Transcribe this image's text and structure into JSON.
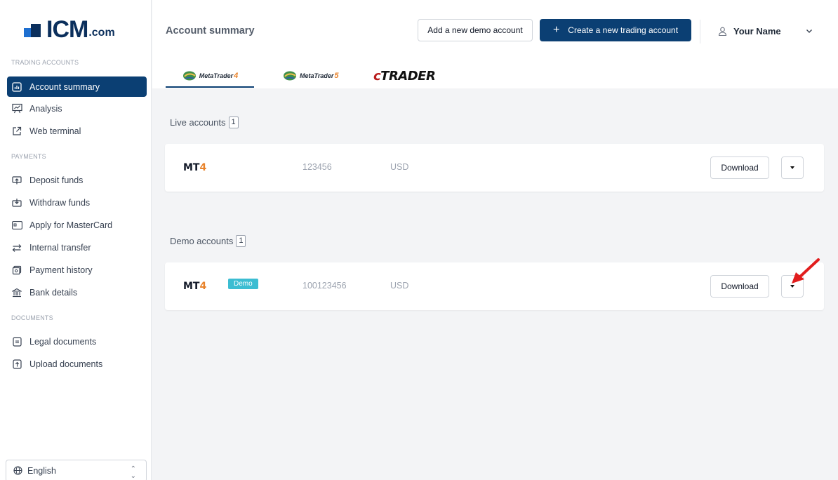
{
  "brand": {
    "name": "ICM",
    "suffix": ".com"
  },
  "sidebar": {
    "sections": [
      {
        "label": "TRADING ACCOUNTS"
      },
      {
        "label": "PAYMENTS"
      },
      {
        "label": "DOCUMENTS"
      }
    ],
    "items": [
      {
        "label": "Account summary",
        "icon": "chart-icon",
        "active": true
      },
      {
        "label": "Analysis",
        "icon": "presentation-icon"
      },
      {
        "label": "Web terminal",
        "icon": "external-link-icon"
      },
      {
        "label": "Deposit funds",
        "icon": "deposit-icon"
      },
      {
        "label": "Withdraw funds",
        "icon": "withdraw-icon"
      },
      {
        "label": "Apply for MasterCard",
        "icon": "card-icon"
      },
      {
        "label": "Internal transfer",
        "icon": "transfer-icon"
      },
      {
        "label": "Payment history",
        "icon": "history-icon"
      },
      {
        "label": "Bank details",
        "icon": "bank-icon"
      },
      {
        "label": "Legal documents",
        "icon": "document-icon"
      },
      {
        "label": "Upload documents",
        "icon": "upload-icon"
      }
    ],
    "language": "English"
  },
  "header": {
    "title": "Account summary",
    "add_demo": "Add a new demo account",
    "create_account": "Create a new trading account",
    "user_name": "Your Name"
  },
  "tabs": [
    {
      "brand": "MetaTrader",
      "num": "4",
      "active": true
    },
    {
      "brand": "MetaTrader",
      "num": "5"
    },
    {
      "label": "TRADER",
      "prefix": "c"
    }
  ],
  "live": {
    "title": "Live accounts",
    "count": "1",
    "platform": "MT",
    "platform_num": "4",
    "account": "123456",
    "currency": "USD",
    "download": "Download"
  },
  "demo": {
    "title": "Demo accounts",
    "count": "1",
    "platform": "MT",
    "platform_num": "4",
    "badge": "Demo",
    "account": "100123456",
    "currency": "USD",
    "download": "Download"
  },
  "colors": {
    "primary": "#0b3f73",
    "accent": "#e8832b",
    "demo_badge": "#3cbdd2",
    "arrow": "#e11d1d"
  }
}
